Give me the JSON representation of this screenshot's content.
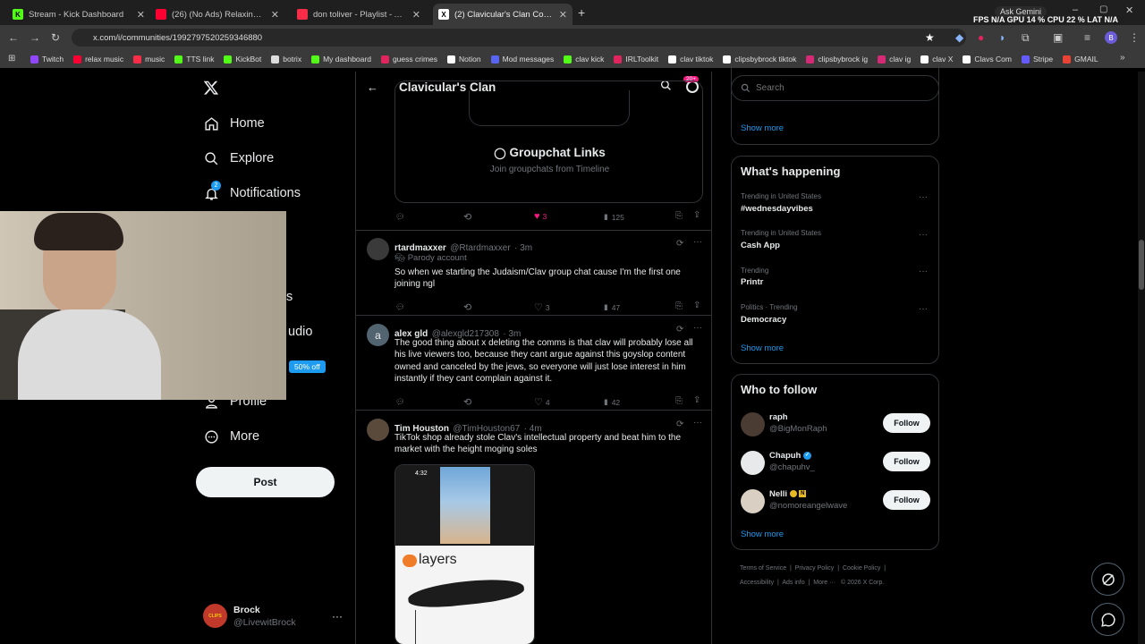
{
  "browser": {
    "tabs": [
      {
        "label": "Stream - Kick Dashboard",
        "favicon_color": "#53fc18"
      },
      {
        "label": "(26) (No Ads) Relaxing Music Fo",
        "favicon_color": "#ff0033"
      },
      {
        "label": "don toliver - Playlist - Apple Mu",
        "favicon_color": "#fa2d48"
      },
      {
        "label": "(2) Clavicular's Clan Community",
        "favicon_color": "#ffffff"
      }
    ],
    "url": "x.com/i/communities/1992797520259346880",
    "ask_gemini": "Ask Gemini",
    "stats": "FPS  N/A  GPU  14 %  CPU  22 %  LAT  N/A",
    "bookmarks": [
      {
        "label": "Twitch",
        "color": "#9146ff"
      },
      {
        "label": "relax music",
        "color": "#ff0033"
      },
      {
        "label": "music",
        "color": "#fa2d48"
      },
      {
        "label": "TTS link",
        "color": "#53fc18"
      },
      {
        "label": "KickBot",
        "color": "#53fc18"
      },
      {
        "label": "botrix",
        "color": "#dddddd"
      },
      {
        "label": "My dashboard",
        "color": "#53fc18"
      },
      {
        "label": "guess crimes",
        "color": "#e0245e"
      },
      {
        "label": "Notion",
        "color": "#ffffff"
      },
      {
        "label": "Mod messages",
        "color": "#5865f2"
      },
      {
        "label": "clav kick",
        "color": "#53fc18"
      },
      {
        "label": "IRLToolkit",
        "color": "#e0245e"
      },
      {
        "label": "clav tiktok",
        "color": "#ffffff"
      },
      {
        "label": "clipsbybrock tiktok",
        "color": "#ffffff"
      },
      {
        "label": "clipsbybrock ig",
        "color": "#d62976"
      },
      {
        "label": "clav ig",
        "color": "#d62976"
      },
      {
        "label": "clav X",
        "color": "#ffffff"
      },
      {
        "label": "Clavs Com",
        "color": "#ffffff"
      },
      {
        "label": "Stripe",
        "color": "#635bff"
      },
      {
        "label": "GMAIL",
        "color": "#ea4335"
      }
    ]
  },
  "nav": {
    "home": "Home",
    "explore": "Explore",
    "notifications": "Notifications",
    "notifications_badge": "2",
    "partial_s": "s",
    "partial_audio": "udio",
    "premium_badge": "50% off",
    "profile": "Profile",
    "more": "More",
    "post": "Post",
    "account_name": "Brock",
    "account_handle": "@LivewitBrock"
  },
  "header": {
    "title": "Clavicular's Clan",
    "badge": "20+"
  },
  "groupchat": {
    "title": "Groupchat Links",
    "subtitle": "Join groupchats from Timeline",
    "likes": "3",
    "views": "125"
  },
  "tweets": [
    {
      "name": "rtardmaxxer",
      "handle": "@Rtardmaxxer",
      "time": "· 3m",
      "label": "Parody account",
      "text": "So when we starting the Judaism/Clav group chat cause I'm the first one joining ngl",
      "likes": "3",
      "views": "47"
    },
    {
      "name": "alex gld",
      "handle": "@alexgld217308",
      "time": "· 3m",
      "avatar_letter": "a",
      "text": "The good thing about x deleting the comms is that clav will probably lose all his live viewers too, because they cant argue against this goyslop content owned and canceled by the jews, so everyone will just lose interest in him instantly if they cant complain against it.",
      "likes": "4",
      "views": "42"
    },
    {
      "name": "Tim Houston",
      "handle": "@TimHouston67",
      "time": "· 4m",
      "text": "TikTok shop already stole Clav's intellectual property and beat him to the market with the height moging soles",
      "image_time": "4:32",
      "image_word": "layers"
    }
  ],
  "search": {
    "placeholder": "Search"
  },
  "right": {
    "show_more_top": "Show more",
    "whats_happening": "What's happening",
    "trends": [
      {
        "meta": "Trending in United States",
        "name": "#wednesdayvibes"
      },
      {
        "meta": "Trending in United States",
        "name": "Cash App"
      },
      {
        "meta": "Trending",
        "name": "Printr"
      },
      {
        "meta": "Politics · Trending",
        "name": "Democracy"
      }
    ],
    "show_more_trends": "Show more",
    "who_to_follow": "Who to follow",
    "follow": [
      {
        "name": "raph",
        "handle": "@BigMonRaph"
      },
      {
        "name": "Chapuh",
        "handle": "@chapuhv_"
      },
      {
        "name": "Nelli",
        "handle": "@nomoreangelwave"
      }
    ],
    "follow_label": "Follow",
    "show_more_follow": "Show more",
    "footer": [
      "Terms of Service",
      "Privacy Policy",
      "Cookie Policy",
      "Accessibility",
      "Ads info",
      "More ···",
      "© 2026 X Corp."
    ]
  }
}
